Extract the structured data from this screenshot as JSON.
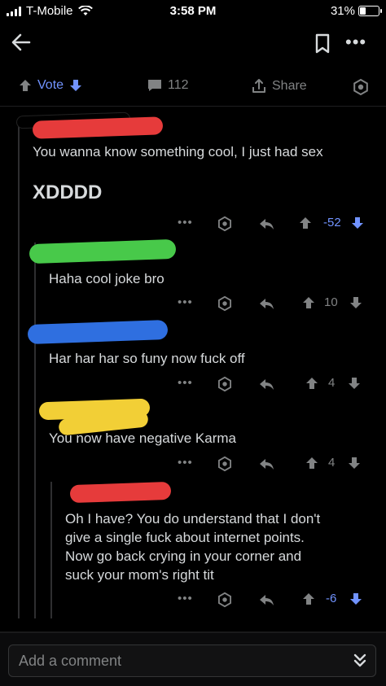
{
  "status_bar": {
    "carrier": "T-Mobile",
    "time": "3:58 PM",
    "battery": "31%"
  },
  "post_actions": {
    "vote_label": "Vote",
    "comment_count": "112",
    "share_label": "Share"
  },
  "comments": [
    {
      "text": "You wanna know something cool, I just had sex",
      "text2": "XDDDD",
      "score": "-52",
      "vote_state": "downvoted"
    },
    {
      "text": "Haha cool joke bro",
      "score": "10",
      "vote_state": "none"
    },
    {
      "text": "Har har har so funy now fuck off",
      "score": "4",
      "vote_state": "none"
    },
    {
      "text": "You now have negative Karma",
      "score": "4",
      "vote_state": "none"
    },
    {
      "lines": [
        "Oh I have? You do understand that I don't",
        "give a single fuck about internet points.",
        "Now go back crying in your corner and",
        "suck your mom's right tit"
      ],
      "score": "-6",
      "vote_state": "downvoted"
    }
  ],
  "composer": {
    "placeholder": "Add a comment"
  },
  "colors": {
    "accent": "#7193ff",
    "text": "#d7dadc",
    "muted": "#818384",
    "redact_red": "#e63b3b",
    "redact_green": "#48c94a",
    "redact_blue": "#2f6fe0",
    "redact_yellow": "#f2cf36"
  }
}
